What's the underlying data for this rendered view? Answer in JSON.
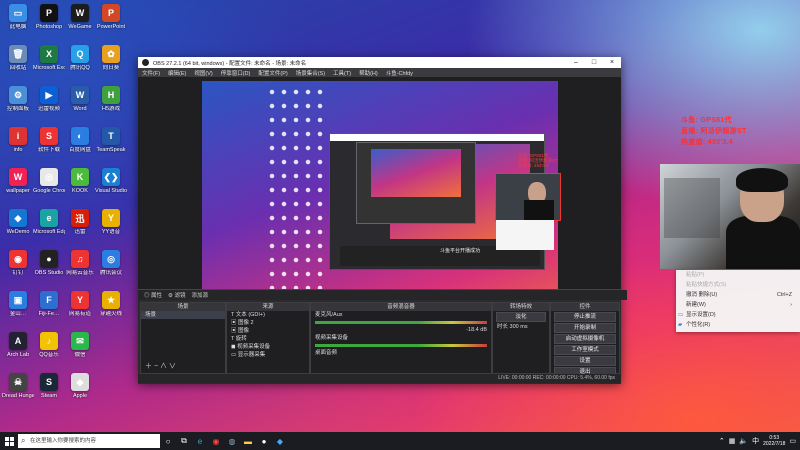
{
  "desktop_icons": [
    {
      "label": "此电脑",
      "color": "#3a8ee6",
      "glyph": "▭"
    },
    {
      "label": "回收站",
      "color": "#6b8bb8",
      "glyph": "🗑"
    },
    {
      "label": "控制面板",
      "color": "#4a90d9",
      "glyph": "⚙"
    },
    {
      "label": "info",
      "color": "#d33",
      "glyph": "i"
    },
    {
      "label": "wallpaper",
      "color": "#e25",
      "glyph": "W"
    },
    {
      "label": "WeDemo",
      "color": "#1477d4",
      "glyph": "◆"
    },
    {
      "label": "钉钉",
      "color": "#e33",
      "glyph": "◉"
    },
    {
      "label": "金山…",
      "color": "#2a7de1",
      "glyph": "▣"
    },
    {
      "label": "Arch Lab",
      "color": "#223",
      "glyph": "A"
    },
    {
      "label": "Dread Hunger",
      "color": "#444",
      "glyph": "☠"
    },
    {
      "label": "Photoshop",
      "color": "#111",
      "glyph": "P"
    },
    {
      "label": "Microsoft Excel",
      "color": "#1d7a43",
      "glyph": "X"
    },
    {
      "label": "迅雷视频",
      "color": "#0d5fd6",
      "glyph": "▶"
    },
    {
      "label": "软件下载",
      "color": "#e33",
      "glyph": "S"
    },
    {
      "label": "Google Chrome",
      "color": "#e8e8e8",
      "glyph": "◎"
    },
    {
      "label": "Microsoft Edge",
      "color": "#1aa3a3",
      "glyph": "e"
    },
    {
      "label": "OBS Studio",
      "color": "#222",
      "glyph": "●"
    },
    {
      "label": "Fiji-Fe…",
      "color": "#2d6fd1",
      "glyph": "F"
    },
    {
      "label": "QQ音乐",
      "color": "#f2c300",
      "glyph": "♪"
    },
    {
      "label": "Steam",
      "color": "#1b2838",
      "glyph": "S"
    },
    {
      "label": "WeGame",
      "color": "#1c1c1c",
      "glyph": "W"
    },
    {
      "label": "腾讯QQ",
      "color": "#27a0e8",
      "glyph": "Q"
    },
    {
      "label": "Word",
      "color": "#2a5caa",
      "glyph": "W"
    },
    {
      "label": "百度网盘",
      "color": "#2a7de1",
      "glyph": "◐"
    },
    {
      "label": "KOOK",
      "color": "#4cba3c",
      "glyph": "K"
    },
    {
      "label": "迅雷",
      "color": "#d81e06",
      "glyph": "迅"
    },
    {
      "label": "网易云音乐",
      "color": "#e33",
      "glyph": "♫"
    },
    {
      "label": "网易有道",
      "color": "#e33",
      "glyph": "Y"
    },
    {
      "label": "微信",
      "color": "#2ab84d",
      "glyph": "✉"
    },
    {
      "label": "Apple",
      "color": "#ddd",
      "glyph": "◆"
    },
    {
      "label": "PowerPoint",
      "color": "#d24726",
      "glyph": "P"
    },
    {
      "label": "向日葵",
      "color": "#e8a020",
      "glyph": "✿"
    },
    {
      "label": "H5游戏",
      "color": "#3fa040",
      "glyph": "H"
    },
    {
      "label": "TeamSpeak",
      "color": "#2458a8",
      "glyph": "T"
    },
    {
      "label": "Visual Studio Code",
      "color": "#1b7fd3",
      "glyph": "❮❯"
    },
    {
      "label": "YY语音",
      "color": "#e8b000",
      "glyph": "Y"
    },
    {
      "label": "腾讯会议",
      "color": "#2a7de1",
      "glyph": "◎"
    },
    {
      "label": "穿越火线",
      "color": "#e8b000",
      "glyph": "★"
    }
  ],
  "obs": {
    "title": "OBS 27.2.1 (64 bit, windows) - 配置文件: 未命名 - 场景: 未命名",
    "menu": [
      "文件(F)",
      "编辑(E)",
      "视图(V)",
      "停靠窗口(D)",
      "配置文件(P)",
      "场景集合(S)",
      "工具(T)",
      "帮助(H)",
      "斗鱼-Chfdy"
    ],
    "dock_tabs": [
      "场景",
      "来源",
      "音频混音器",
      "转场特效",
      "控件"
    ],
    "source_bar": [
      "◎ 属性",
      "⚙ 滤镜",
      "添加源"
    ],
    "scenes": [
      "场景"
    ],
    "sources": [
      "文本 (GDI+)",
      "图像 2",
      "图像",
      "旋转",
      "视频采集设备",
      "显示器采集"
    ],
    "mixer": [
      {
        "name": "麦克风/Aux",
        "db": "-18.4 dB"
      },
      {
        "name": "视频采集设备",
        "db": "0.0 dB"
      },
      {
        "name": "桌面音频",
        "db": "0.0 dB"
      }
    ],
    "transition": {
      "name": "淡化",
      "duration_label": "时长",
      "duration": "300 ms"
    },
    "controls": [
      "停止推流",
      "开始录制",
      "启动虚拟摄像机",
      "工作室模式",
      "设置",
      "退出"
    ],
    "status": "LIVE: 00:00:00   REC: 00:00:00   CPU: 5.4%, 60.00 fps"
  },
  "overlay_text": [
    "斗鱼: GPS81代",
    "直播: 阿活伊超游ST",
    "热度值: 493'3.4"
  ],
  "preview_label": "斗鱼平台开播成功",
  "context_menu": [
    {
      "label": "粘贴(P)",
      "shortcut": "",
      "dim": true
    },
    {
      "label": "粘贴快捷方式(S)",
      "shortcut": "",
      "dim": true
    },
    {
      "label": "撤消 删除(U)",
      "shortcut": "Ctrl+Z",
      "dim": false
    },
    {
      "label": "新建(W)",
      "shortcut": "›",
      "dim": false
    },
    {
      "label": "显示设置(D)",
      "shortcut": "",
      "dim": false
    },
    {
      "label": "个性化(R)",
      "shortcut": "",
      "dim": false
    }
  ],
  "taskbar": {
    "search_placeholder": "在这里输入你要搜索的内容",
    "time": "0:53",
    "date": "2022/7/18",
    "lang": "中"
  }
}
